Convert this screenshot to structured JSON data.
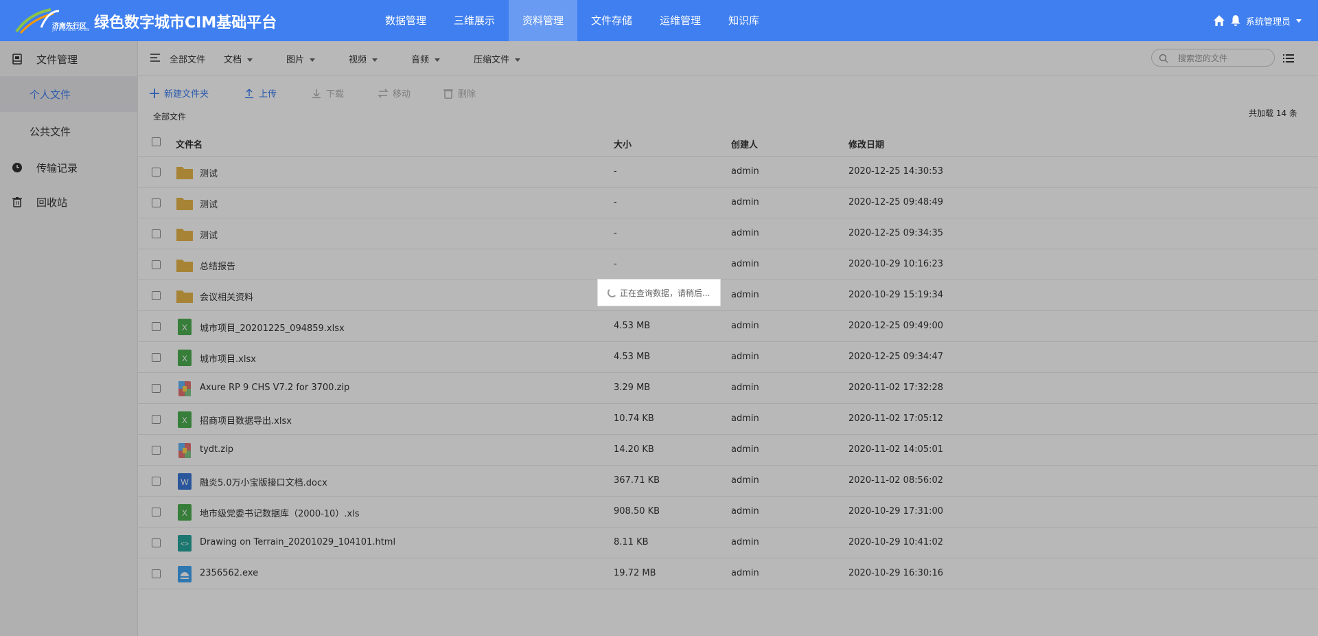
{
  "header": {
    "logo_cn": "济南先行区",
    "logo_en": "JN Pioneer Area",
    "title": "绿色数字城市CIM基础平台",
    "nav": [
      {
        "label": "数据管理",
        "active": false
      },
      {
        "label": "三维展示",
        "active": false
      },
      {
        "label": "资料管理",
        "active": true
      },
      {
        "label": "文件存储",
        "active": false
      },
      {
        "label": "运维管理",
        "active": false
      },
      {
        "label": "知识库",
        "active": false
      }
    ],
    "user": "系统管理员"
  },
  "sidebar": {
    "items": [
      {
        "label": "文件管理",
        "icon": "drive-icon"
      },
      {
        "label": "个人文件",
        "active": true
      },
      {
        "label": "公共文件"
      },
      {
        "label": "传输记录",
        "icon": "clock-icon"
      },
      {
        "label": "回收站",
        "icon": "trash-icon"
      }
    ]
  },
  "filters": {
    "all": "全部文件",
    "doc": "文档",
    "image": "图片",
    "video": "视频",
    "audio": "音频",
    "zip": "压缩文件"
  },
  "search": {
    "placeholder": "搜索您的文件"
  },
  "toolbar": {
    "new_folder": "新建文件夹",
    "upload": "上传",
    "download": "下载",
    "move": "移动",
    "delete": "删除"
  },
  "breadcrumb": "全部文件",
  "total": "共加载 14 条",
  "table": {
    "columns": {
      "name": "文件名",
      "size": "大小",
      "creator": "创建人",
      "date": "修改日期"
    },
    "rows": [
      {
        "type": "folder",
        "name": "测试",
        "size": "-",
        "creator": "admin",
        "date": "2020-12-25 14:30:53"
      },
      {
        "type": "folder",
        "name": "测试",
        "size": "-",
        "creator": "admin",
        "date": "2020-12-25 09:48:49"
      },
      {
        "type": "folder",
        "name": "测试",
        "size": "-",
        "creator": "admin",
        "date": "2020-12-25 09:34:35"
      },
      {
        "type": "folder",
        "name": "总结报告",
        "size": "-",
        "creator": "admin",
        "date": "2020-10-29 10:16:23"
      },
      {
        "type": "folder",
        "name": "会议相关资料",
        "size": "-",
        "creator": "admin",
        "date": "2020-10-29 15:19:34"
      },
      {
        "type": "excel",
        "name": "城市项目_20201225_094859.xlsx",
        "size": "4.53 MB",
        "creator": "admin",
        "date": "2020-12-25 09:49:00"
      },
      {
        "type": "excel",
        "name": "城市项目.xlsx",
        "size": "4.53 MB",
        "creator": "admin",
        "date": "2020-12-25 09:34:47"
      },
      {
        "type": "zip",
        "name": "Axure RP 9 CHS V7.2 for 3700.zip",
        "size": "3.29 MB",
        "creator": "admin",
        "date": "2020-11-02 17:32:28"
      },
      {
        "type": "excel",
        "name": "招商项目数据导出.xlsx",
        "size": "10.74 KB",
        "creator": "admin",
        "date": "2020-11-02 17:05:12"
      },
      {
        "type": "zip",
        "name": "tydt.zip",
        "size": "14.20 KB",
        "creator": "admin",
        "date": "2020-11-02 14:05:01"
      },
      {
        "type": "word",
        "name": "融炎5.0万小宝版接口文档.docx",
        "size": "367.71 KB",
        "creator": "admin",
        "date": "2020-11-02 08:56:02"
      },
      {
        "type": "excel",
        "name": "地市级党委书记数据库（2000-10）.xls",
        "size": "908.50 KB",
        "creator": "admin",
        "date": "2020-10-29 17:31:00"
      },
      {
        "type": "html",
        "name": "Drawing on Terrain_20201029_104101.html",
        "size": "8.11 KB",
        "creator": "admin",
        "date": "2020-10-29 10:41:02"
      },
      {
        "type": "exe",
        "name": "2356562.exe",
        "size": "19.72 MB",
        "creator": "admin",
        "date": "2020-10-29 16:30:16"
      }
    ]
  },
  "loading": "正在查询数据，请稍后...",
  "colors": {
    "primary": "#3f7ff0",
    "folder": "#e8b84a",
    "excel": "#4caf50",
    "word": "#3b78d8",
    "html": "#26a69a"
  }
}
